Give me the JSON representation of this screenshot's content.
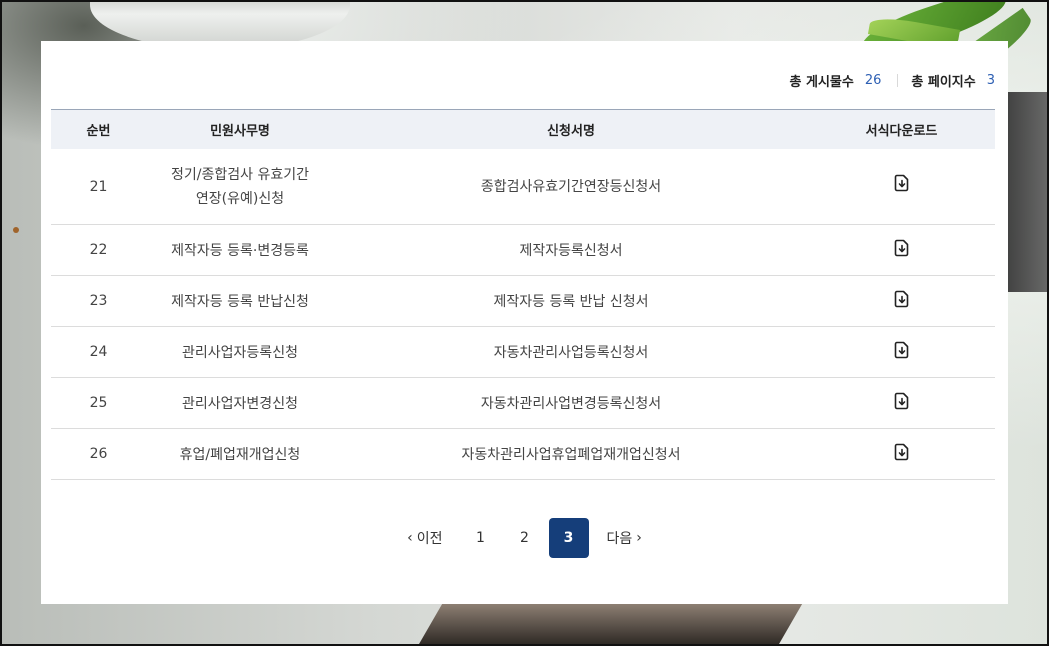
{
  "summary": {
    "total_posts_label": "총 게시물수",
    "total_posts": "26",
    "total_pages_label": "총 페이지수",
    "total_pages": "3"
  },
  "table": {
    "headers": [
      "순번",
      "민원사무명",
      "신청서명",
      "서식다운로드"
    ],
    "rows": [
      {
        "no": "21",
        "service_line1": "정기/종합검사 유효기간",
        "service_line2": "연장(유예)신청",
        "form": "종합검사유효기간연장등신청서"
      },
      {
        "no": "22",
        "service": "제작자등 등록·변경등록",
        "form": "제작자등록신청서"
      },
      {
        "no": "23",
        "service": "제작자등 등록 반납신청",
        "form": "제작자등 등록 반납 신청서"
      },
      {
        "no": "24",
        "service": "관리사업자등록신청",
        "form": "자동차관리사업등록신청서"
      },
      {
        "no": "25",
        "service": "관리사업자변경신청",
        "form": "자동차관리사업변경등록신청서"
      },
      {
        "no": "26",
        "service": "휴업/폐업재개업신청",
        "form": "자동차관리사업휴업폐업재개업신청서"
      }
    ],
    "download_icon": "file-download-icon"
  },
  "pagination": {
    "prev_label": "이전",
    "next_label": "다음",
    "pages": [
      "1",
      "2",
      "3"
    ],
    "current": "3"
  },
  "colors": {
    "accent": "#153e7a",
    "count_text": "#2d5fb3",
    "header_bg": "#eef1f6"
  }
}
